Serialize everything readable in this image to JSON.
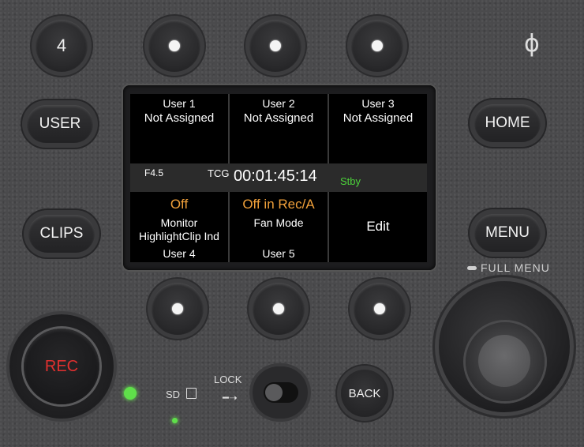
{
  "top_button_label": "4",
  "power_symbol": "ϕ",
  "side_buttons": {
    "user": "USER",
    "clips": "CLIPS",
    "home": "HOME",
    "menu": "MENU"
  },
  "full_menu_label": "FULL MENU",
  "lcd": {
    "user1": {
      "title": "User 1",
      "value": "Not Assigned"
    },
    "user2": {
      "title": "User 2",
      "value": "Not Assigned"
    },
    "user3": {
      "title": "User 3",
      "value": "Not Assigned"
    },
    "status": {
      "fstop": "F4.5",
      "tc_label": "TCG",
      "timecode": "00:01:45:14",
      "state": "Stby"
    },
    "user4": {
      "state": "Off",
      "line1": "Monitor",
      "line2": "HighlightClip Ind",
      "title": "User 4"
    },
    "user5": {
      "state": "Off in Rec/A",
      "line1": "Fan Mode",
      "title": "User 5"
    },
    "edit": "Edit"
  },
  "rec_label": "REC",
  "sd_label": "SD",
  "lock_label": "LOCK",
  "back_label": "BACK",
  "colors": {
    "rec_text": "#e0302f",
    "orange_value": "#f0a03a",
    "stby_green": "#4cd23a",
    "led_green": "#5fe04a"
  }
}
